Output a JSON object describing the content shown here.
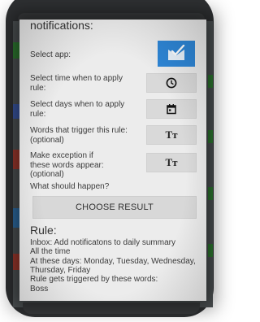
{
  "dialog": {
    "title": "notifications:",
    "rows": [
      {
        "label": "Select app:",
        "icon": "mail-app-icon"
      },
      {
        "label_line1": "Select time when to apply",
        "label_line2": "rule:",
        "icon": "clock-icon"
      },
      {
        "label_line1": "Select days when to apply",
        "label_line2": "rule:",
        "icon": "calendar-icon"
      },
      {
        "label_line1": "Words that trigger this rule:",
        "label_line2": "(optional)",
        "button_text": "Tт"
      },
      {
        "label_line1": "Make exception if",
        "label_line2": "these words appear:",
        "label_line3": "(optional)",
        "button_text": "Tт"
      }
    ],
    "question": "What should happen?",
    "choose_button": "CHOOSE RESULT",
    "rule": {
      "title": "Rule:",
      "lines": [
        "Inbox: Add notificatons to daily summary",
        "All the time",
        "At these days: Monday, Tuesday, Wednesday,",
        "Thursday, Friday",
        "Rule gets triggered by these words:",
        "Boss"
      ]
    }
  },
  "colors": {
    "accent": "#2e86d6",
    "background_strip": "#2f7d32"
  }
}
